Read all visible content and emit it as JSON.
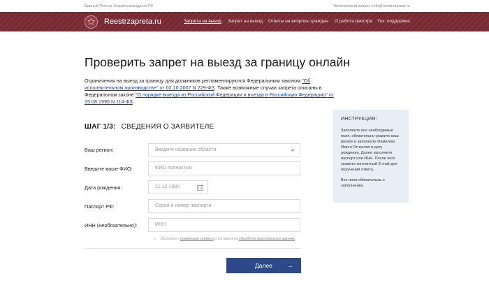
{
  "topbar": {
    "left_text": "Единый Реестр Запрета выезда из РФ",
    "right_text": "Электронный запрос: info@reestrzapreta.ru"
  },
  "header": {
    "logo_text": "Reestrzapreta.ru",
    "nav": [
      {
        "label": "Запрета на выезд",
        "active": true
      },
      {
        "label": "Запрет на выезд",
        "active": false
      },
      {
        "label": "Ответы на вопросы граждан",
        "active": false
      },
      {
        "label": "О работе реестра",
        "active": false
      },
      {
        "label": "Тех. поддержка",
        "active": false
      }
    ]
  },
  "main": {
    "title": "Проверить запрет на выезд за границу онлайн",
    "intro": {
      "p1": "Ограничения на выезд за границу для должников регламентируются Федеральным законом ",
      "link1": "\"Об исполнительном производстве\" от 02.10.2007 N 229-ФЗ",
      "p2": ". Также возможные случаи запрета описаны в Федеральном законе ",
      "link2": "\"О порядке выезда из Российской Федерации и въезда в Российскую Федерацию\" от 15.08.1996 N 114-ФЗ",
      "p3": "."
    },
    "step": {
      "number": "ШАГ 1/3:",
      "title": "СВЕДЕНИЯ О ЗАЯВИТЕЛЕ"
    }
  },
  "form": {
    "region": {
      "label": "Ваш регион:",
      "placeholder": "Введите название области"
    },
    "fio": {
      "label": "Введите ваше ФИО:",
      "placeholder": "ФИО полностью"
    },
    "birth": {
      "label": "Дата рождения:",
      "placeholder": "21.12.1980"
    },
    "passport": {
      "label": "Паспорт РФ:",
      "placeholder": "Серия и номер паспорта"
    },
    "inn": {
      "label": "ИНН (необязательно):",
      "placeholder": "ИНН"
    },
    "consent": {
      "check": "✓",
      "t1": "Согласен с ",
      "link1": "правилами сервиса",
      "t2": " и согласен на ",
      "link2": "обработку персональных данных"
    },
    "submit_label": "Далее",
    "submit_arrow": "→"
  },
  "info": {
    "title": "ИНСТРУКЦИЯ:",
    "text1": "Заполните все необходимые поля, обязательно укажите ваш регион и заполните Фамилию, Имя и Отчество и дату рождения. Далее заполните паспорт или ИНН. После чего укажите контактный E-mail для получения ответа.",
    "text2": "Все поля обязательны к заполнению."
  },
  "colors": {
    "header_bg": "#7a2a33",
    "button_bg": "#2c4a8a",
    "link": "#1a3fa6",
    "info_bg": "#e7eef6"
  }
}
